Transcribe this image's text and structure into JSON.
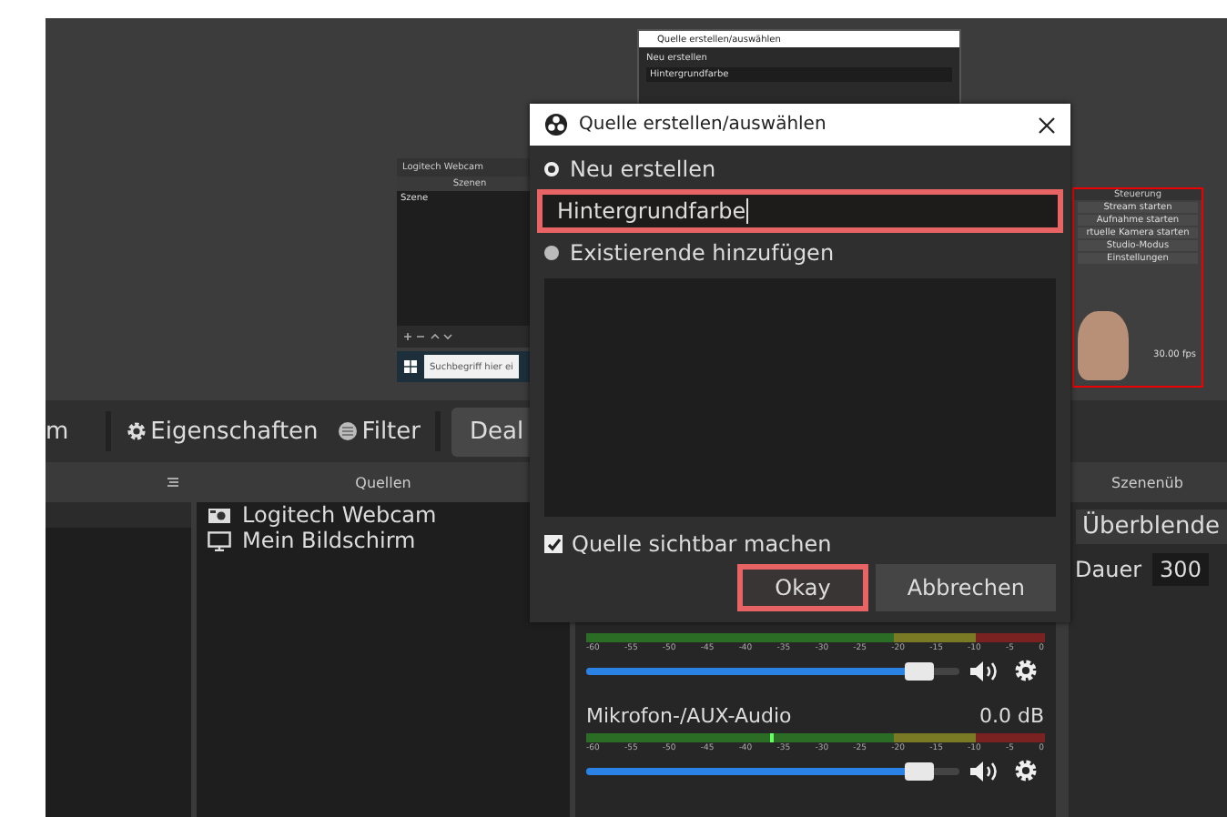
{
  "preview": {
    "webcam_window": {
      "title": "Logitech Webcam",
      "header": "Szenen",
      "item": "Szene"
    },
    "taskbar": {
      "search_placeholder": "Suchbegriff hier ei"
    },
    "mini_dialog": {
      "title": "Quelle erstellen/auswählen",
      "option": "Neu erstellen",
      "value": "Hintergrundfarbe"
    },
    "controls_panel": {
      "header": "Steuerung",
      "buttons": [
        "Stream starten",
        "Aufnahme starten",
        "rtuelle Kamera starten",
        "Studio-Modus",
        "Einstellungen"
      ],
      "fps": "30.00 fps"
    }
  },
  "toolbar": {
    "items": [
      {
        "kind": "text",
        "label": "m"
      },
      {
        "kind": "properties",
        "label": "Eigenschaften"
      },
      {
        "kind": "filter",
        "label": "Filter"
      },
      {
        "kind": "button",
        "label": "Deal"
      }
    ]
  },
  "sources": {
    "title": "Quellen",
    "items": [
      {
        "kind": "camera",
        "label": "Logitech Webcam"
      },
      {
        "kind": "display",
        "label": "Mein Bildschirm"
      }
    ]
  },
  "mixer": {
    "channels": [
      {
        "level": 0.93,
        "scale": [
          "-60",
          "-55",
          "-50",
          "-45",
          "-40",
          "-35",
          "-30",
          "-25",
          "-20",
          "-15",
          "-10",
          "-5",
          "0"
        ]
      },
      {
        "name": "Mikrofon-/AUX-Audio",
        "reading": "0.0 dB",
        "level": 0.93,
        "scale": [
          "-60",
          "-55",
          "-50",
          "-45",
          "-40",
          "-35",
          "-30",
          "-25",
          "-20",
          "-15",
          "-10",
          "-5",
          "0"
        ]
      }
    ]
  },
  "transitions": {
    "title": "Szenenüb",
    "transition": "Überblende",
    "duration_label": "Dauer",
    "duration": "300"
  },
  "dialog": {
    "title": "Quelle erstellen/auswählen",
    "options": [
      {
        "label": "Neu erstellen",
        "selected": true
      },
      {
        "label": "Existierende hinzufügen",
        "selected": false
      }
    ],
    "name_field": {
      "value": "Hintergrundfarbe",
      "highlighted": true
    },
    "visible_checkbox": {
      "label": "Quelle sichtbar machen",
      "checked": true
    },
    "buttons": [
      {
        "label": "Okay",
        "highlighted": true
      },
      {
        "label": "Abbrechen",
        "highlighted": false
      }
    ]
  }
}
